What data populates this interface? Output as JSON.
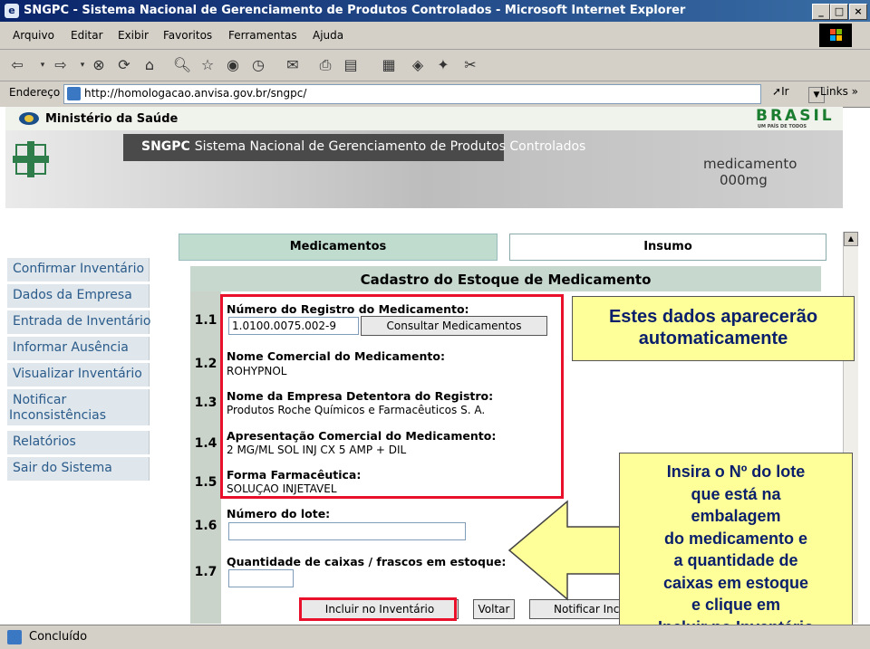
{
  "window": {
    "title": "SNGPC - Sistema Nacional de Gerenciamento de Produtos Controlados - Microsoft Internet Explorer",
    "controls": {
      "minimize": "_",
      "maximize": "□",
      "close": "×"
    }
  },
  "menu": {
    "items": [
      "Arquivo",
      "Editar",
      "Exibir",
      "Favoritos",
      "Ferramentas",
      "Ajuda"
    ]
  },
  "toolbar": {
    "icons": [
      "back-icon",
      "forward-icon",
      "stop-icon",
      "refresh-icon",
      "home-icon",
      "search-icon",
      "favorites-icon",
      "media-icon",
      "history-icon",
      "mail-icon",
      "print-icon",
      "edit-icon",
      "discuss-icon",
      "messenger-icon",
      "research-icon",
      "tools-icon"
    ]
  },
  "address": {
    "label": "Endereço",
    "url": "http://homologacao.anvisa.gov.br/sngpc/",
    "go": "Ir",
    "links": "Links"
  },
  "header": {
    "ministerio": "Ministério da Saúde",
    "brazil": "BRASIL",
    "brazil_sub": "UM PAÍS DE TODOS",
    "sngpc": "SNGPC",
    "sistema": "Sistema Nacional de Gerenciamento de Produtos Controlados",
    "med_line1": "medicamento",
    "med_line2": "000mg"
  },
  "sidebar": {
    "items": [
      {
        "label": "Confirmar Inventário"
      },
      {
        "label": "Dados da Empresa"
      },
      {
        "label": "Entrada de Inventário"
      },
      {
        "label": "Informar Ausência"
      },
      {
        "label": "Visualizar Inventário"
      },
      {
        "label": "Notificar",
        "label2": "Inconsistências"
      },
      {
        "label": "Relatórios"
      },
      {
        "label": "Sair do Sistema"
      }
    ]
  },
  "tabs": {
    "medicamentos": "Medicamentos",
    "insumo": "Insumo"
  },
  "form": {
    "title": "Cadastro do Estoque de Medicamento",
    "fields": [
      {
        "num": "1.1",
        "label": "Número do Registro do Medicamento:",
        "value": "1.0100.0075.002-9",
        "button": "Consultar Medicamentos"
      },
      {
        "num": "1.2",
        "label": "Nome Comercial do Medicamento:",
        "value": "ROHYPNOL"
      },
      {
        "num": "1.3",
        "label": "Nome da Empresa Detentora do Registro:",
        "value": "Produtos Roche Químicos e Farmacêuticos S. A."
      },
      {
        "num": "1.4",
        "label": "Apresentação Comercial do Medicamento:",
        "value": "2 MG/ML SOL INJ CX 5 AMP + DIL"
      },
      {
        "num": "1.5",
        "label": "Forma Farmacêutica:",
        "value": "SOLUÇAO INJETAVEL"
      },
      {
        "num": "1.6",
        "label": "Número do lote:",
        "value": ""
      },
      {
        "num": "1.7",
        "label": "Quantidade de caixas / frascos em estoque:",
        "value": ""
      }
    ],
    "buttons": {
      "incluir": "Incluir no Inventário",
      "voltar": "Voltar",
      "notificar": "Notificar Inco"
    }
  },
  "callouts": {
    "top_line1": "Estes dados aparecerão",
    "top_line2": "automaticamente",
    "bottom_lines": [
      "Insira o Nº do lote",
      "que está na",
      "embalagem",
      "do medicamento e",
      "a quantidade de",
      "caixas em estoque",
      "e clique em",
      "Incluir no Inventário"
    ]
  },
  "status": {
    "text": "Concluído"
  },
  "colors": {
    "accent_red": "#e8102a",
    "callout_bg": "#ffff99",
    "callout_text": "#0a1f6b",
    "titlebar": "#0a246a"
  }
}
